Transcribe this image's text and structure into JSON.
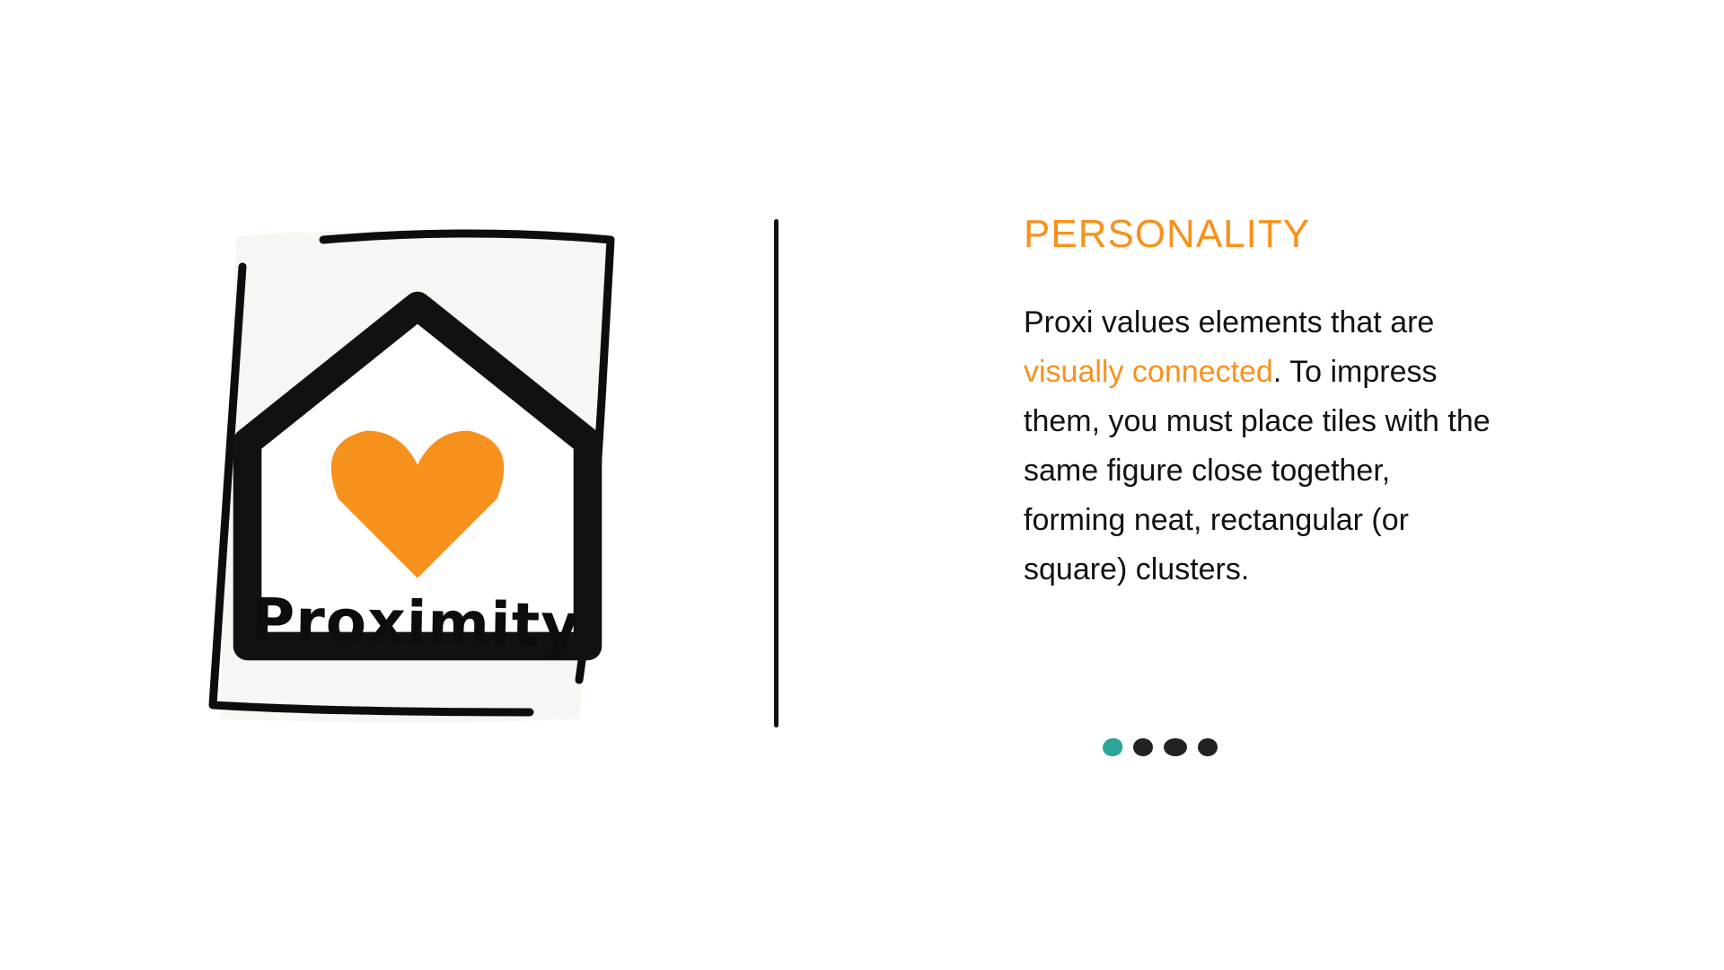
{
  "card": {
    "title": "Proximity",
    "badge_icon": "home-heart-icon",
    "illustration": "person-hugging-flowers-illustration"
  },
  "panel": {
    "heading": "PERSONALITY",
    "body_part1": "Proxi values elements that are ",
    "body_highlight": "visually connected",
    "body_part2": ". To impress them, you must place tiles with the same figure close together, forming neat, rectangular (or square) clusters."
  },
  "pager": {
    "total": 4,
    "active_index": 0
  },
  "colors": {
    "accent": "#f7911d",
    "active_dot": "#2aa597",
    "ink": "#111111",
    "card_bg": "#f7f6f3"
  }
}
